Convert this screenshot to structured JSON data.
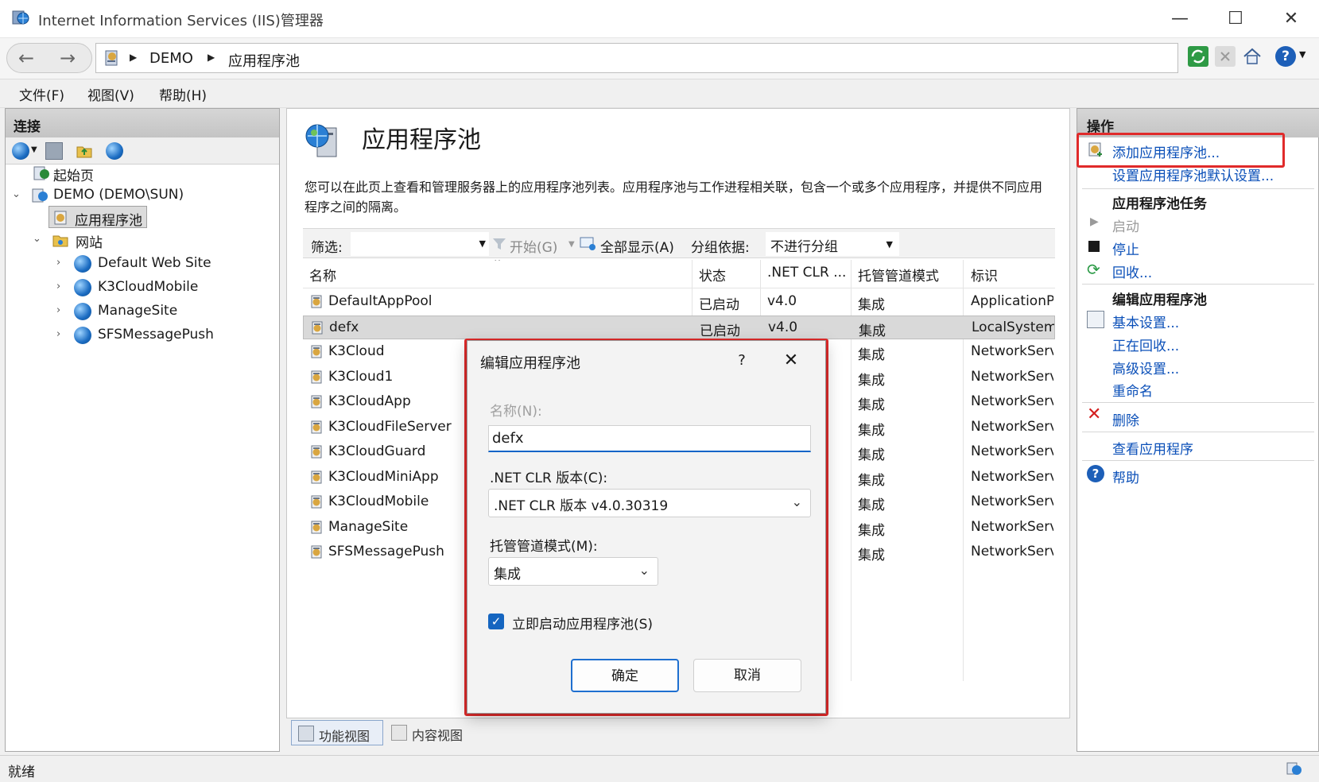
{
  "window": {
    "title": "Internet Information Services (IIS)管理器",
    "minimize": "—",
    "maximize": "☐",
    "close": "✕"
  },
  "address": {
    "crumbs": [
      "DEMO",
      "应用程序池"
    ]
  },
  "menu": {
    "file": "文件(F)",
    "view": "视图(V)",
    "help": "帮助(H)"
  },
  "connections": {
    "header": "连接",
    "tree": {
      "start_page": "起始页",
      "server": "DEMO (DEMO\\SUN)",
      "app_pools": "应用程序池",
      "sites": "网站",
      "site_list": [
        "Default Web Site",
        "K3CloudMobile",
        "ManageSite",
        "SFSMessagePush"
      ]
    }
  },
  "main": {
    "title": "应用程序池",
    "description": "您可以在此页上查看和管理服务器上的应用程序池列表。应用程序池与工作进程相关联，包含一个或多个应用程序，并提供不同应用程序之间的隔离。",
    "filter": {
      "label": "筛选:",
      "start": "开始(G)",
      "show_all": "全部显示(A)",
      "group_by_label": "分组依据:",
      "group_by_value": "不进行分组"
    },
    "columns": [
      "名称",
      "状态",
      ".NET CLR ...",
      "托管管道模式",
      "标识"
    ],
    "rows": [
      {
        "name": "DefaultAppPool",
        "status": "已启动",
        "clr": "v4.0",
        "mode": "集成",
        "identity": "ApplicationPoolIdentity"
      },
      {
        "name": "defx",
        "status": "已启动",
        "clr": "v4.0",
        "mode": "集成",
        "identity": "LocalSystem"
      },
      {
        "name": "K3Cloud",
        "status": "",
        "clr": "",
        "mode": "集成",
        "identity": "NetworkService"
      },
      {
        "name": "K3Cloud1",
        "status": "",
        "clr": "",
        "mode": "集成",
        "identity": "NetworkService"
      },
      {
        "name": "K3CloudApp",
        "status": "",
        "clr": "",
        "mode": "集成",
        "identity": "NetworkService"
      },
      {
        "name": "K3CloudFileServer",
        "status": "",
        "clr": "",
        "mode": "集成",
        "identity": "NetworkService"
      },
      {
        "name": "K3CloudGuard",
        "status": "",
        "clr": "",
        "mode": "集成",
        "identity": "NetworkService"
      },
      {
        "name": "K3CloudMiniApp",
        "status": "",
        "clr": "",
        "mode": "集成",
        "identity": "NetworkService"
      },
      {
        "name": "K3CloudMobile",
        "status": "",
        "clr": "",
        "mode": "集成",
        "identity": "NetworkService"
      },
      {
        "name": "ManageSite",
        "status": "",
        "clr": "",
        "mode": "集成",
        "identity": "NetworkService"
      },
      {
        "name": "SFSMessagePush",
        "status": "",
        "clr": "",
        "mode": "集成",
        "identity": "NetworkService"
      }
    ],
    "view_tabs": {
      "features": "功能视图",
      "content": "内容视图"
    }
  },
  "actions": {
    "header": "操作",
    "add_pool": "添加应用程序池...",
    "set_defaults": "设置应用程序池默认设置...",
    "tasks_header": "应用程序池任务",
    "start": "启动",
    "stop": "停止",
    "recycle": "回收...",
    "edit_header": "编辑应用程序池",
    "basic_settings": "基本设置...",
    "recycling": "正在回收...",
    "advanced_settings": "高级设置...",
    "rename": "重命名",
    "delete": "删除",
    "view_apps": "查看应用程序",
    "help": "帮助"
  },
  "status": {
    "text": "就绪"
  },
  "dialog": {
    "title": "编辑应用程序池",
    "help": "?",
    "close": "✕",
    "name_label": "名称(N):",
    "name_value": "defx",
    "clr_label": ".NET CLR 版本(C):",
    "clr_value": ".NET CLR 版本 v4.0.30319",
    "mode_label": "托管管道模式(M):",
    "mode_value": "集成",
    "start_checkbox": "立即启动应用程序池(S)",
    "start_checked": true,
    "ok": "确定",
    "cancel": "取消"
  },
  "colors": {
    "link": "#0a4fb8",
    "highlight": "#e02a2a",
    "accent": "#1565c0"
  }
}
